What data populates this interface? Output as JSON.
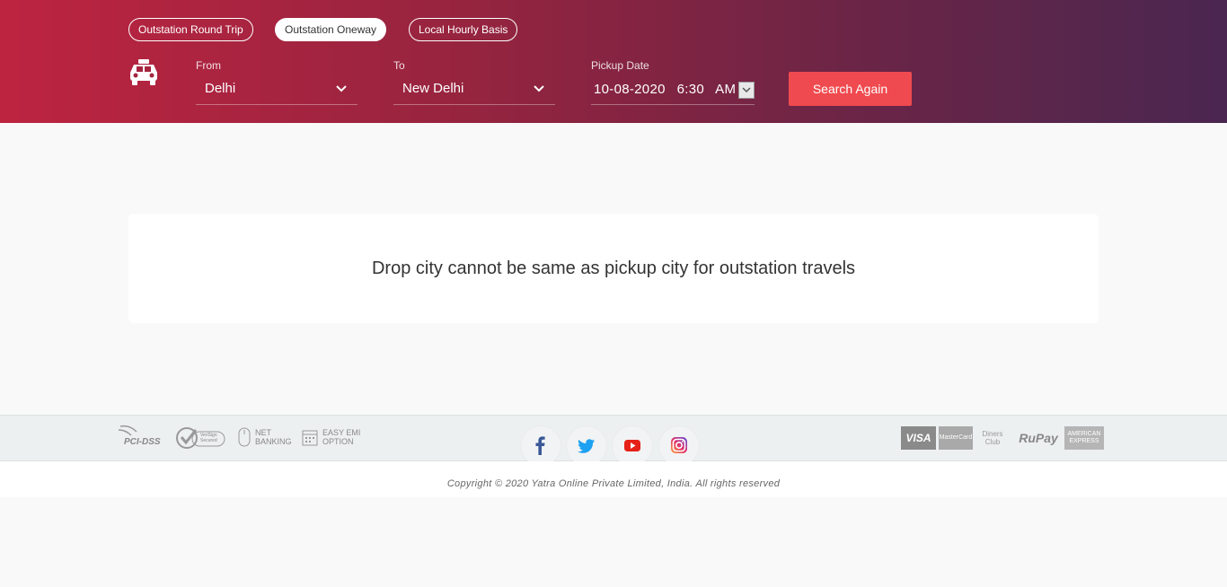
{
  "header": {
    "trip_tabs": [
      {
        "label": "Outstation Round Trip",
        "active": false
      },
      {
        "label": "Outstation Oneway",
        "active": true
      },
      {
        "label": "Local Hourly Basis",
        "active": false
      }
    ],
    "from": {
      "label": "From",
      "value": "Delhi"
    },
    "to": {
      "label": "To",
      "value": "New Delhi"
    },
    "pickup": {
      "label": "Pickup Date",
      "value": "10-08-2020  6:30  AM"
    },
    "search_label": "Search Again",
    "colors": {
      "gradient_start": "#bd2440",
      "gradient_end": "#4a2650",
      "button": "#ef4a4f"
    }
  },
  "message": {
    "text": "Drop city cannot be same as pickup city for outstation travels"
  },
  "footer": {
    "trust_badges": [
      {
        "icon": "pci-dss-icon",
        "text": "PCI-DSS"
      },
      {
        "icon": "verisign-icon",
        "text": "VeriSign Secured"
      },
      {
        "icon": "mouse-icon",
        "line1": "NET",
        "line2": "BANKING"
      },
      {
        "icon": "calendar-icon",
        "line1": "EASY EMI",
        "line2": "OPTION"
      }
    ],
    "social": [
      "facebook-icon",
      "twitter-icon",
      "youtube-icon",
      "instagram-icon"
    ],
    "payments": {
      "visa": "VISA",
      "mastercard": "MasterCard",
      "diners": "Diners Club",
      "rupay": "RuPay",
      "amex": "AMERICAN EXPRESS"
    },
    "copyright": "Copyright © 2020 Yatra Online Private Limited, India. All rights reserved"
  }
}
